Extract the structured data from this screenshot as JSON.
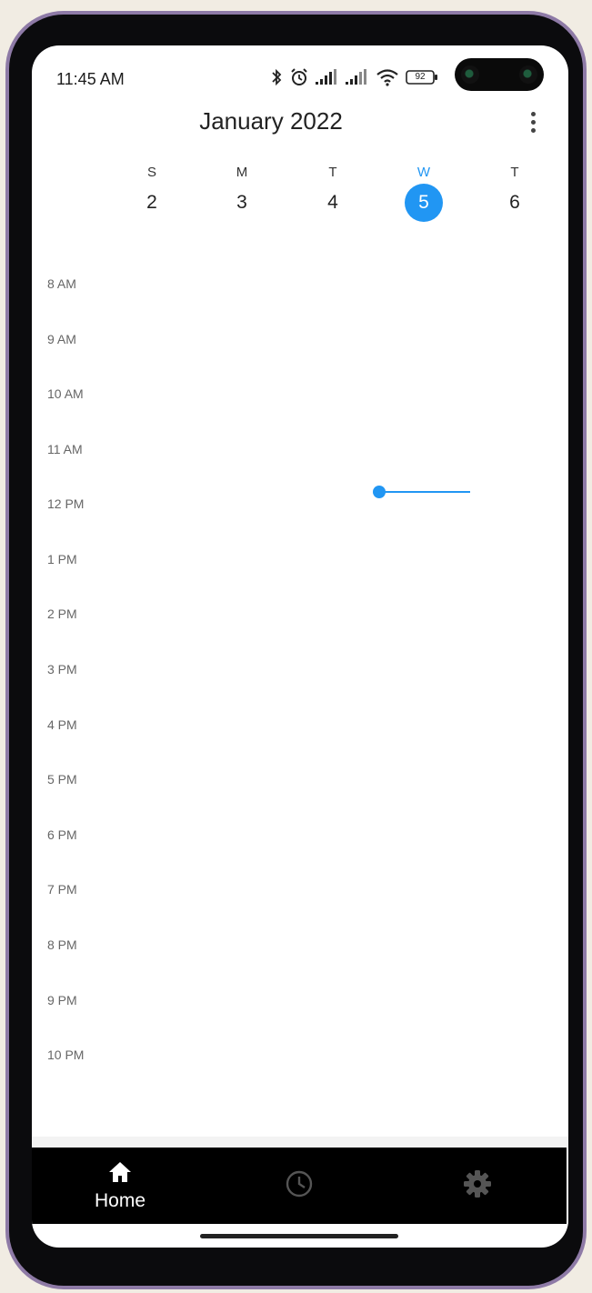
{
  "status_bar": {
    "time": "11:45 AM",
    "battery": "92",
    "icons": [
      "bluetooth-icon",
      "alarm-icon",
      "signal-icon",
      "signal-icon",
      "wifi-icon",
      "battery-icon"
    ]
  },
  "header": {
    "title": "January 2022",
    "menu_icon": "more-vert-icon"
  },
  "week": {
    "days": [
      {
        "letter": "S",
        "number": "2",
        "today": false
      },
      {
        "letter": "M",
        "number": "3",
        "today": false
      },
      {
        "letter": "T",
        "number": "4",
        "today": false
      },
      {
        "letter": "W",
        "number": "5",
        "today": true
      },
      {
        "letter": "T",
        "number": "6",
        "today": false
      }
    ]
  },
  "timeline": {
    "hours": [
      "8 AM",
      "9 AM",
      "10 AM",
      "11 AM",
      "12 PM",
      "1 PM",
      "2 PM",
      "3 PM",
      "4 PM",
      "5 PM",
      "6 PM",
      "7 PM",
      "8 PM",
      "9 PM",
      "10 PM"
    ],
    "current_time_indicator_color": "#2196f3"
  },
  "bottom_nav": {
    "items": [
      {
        "label": "Home",
        "icon": "home-icon",
        "active": true
      },
      {
        "label": "",
        "icon": "clock-icon",
        "active": false
      },
      {
        "label": "",
        "icon": "gear-icon",
        "active": false
      }
    ]
  },
  "colors": {
    "accent": "#2196f3",
    "nav_background": "#000000"
  }
}
